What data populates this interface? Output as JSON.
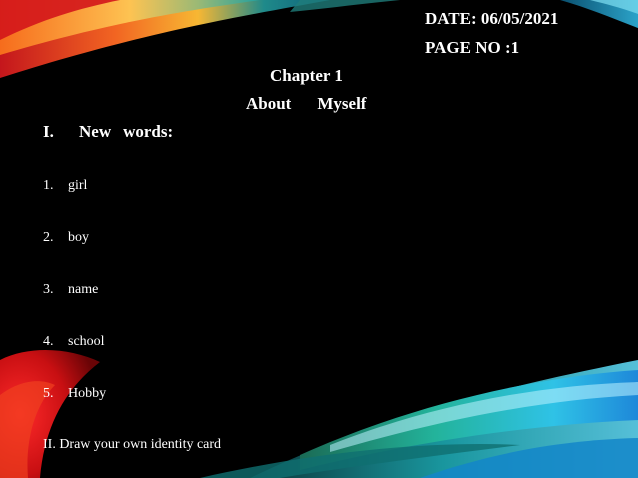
{
  "header": {
    "date": "DATE: 06/05/2021",
    "page_no": "PAGE NO :1"
  },
  "title": {
    "chapter": "Chapter 1",
    "subtitle_word1": "About",
    "subtitle_word2": "Myself"
  },
  "section": {
    "numeral": "I.",
    "word1": "New",
    "word2": "words:"
  },
  "words": [
    {
      "num": "1.",
      "text": "girl"
    },
    {
      "num": "2.",
      "text": "boy"
    },
    {
      "num": "3.",
      "text": "name"
    },
    {
      "num": "4.",
      "text": "school"
    },
    {
      "num": "5.",
      "text": "Hobby"
    }
  ],
  "task": "II. Draw your own identity card",
  "colors": {
    "background": "#000000",
    "text": "#ffffff",
    "accent_red": "#d81b1b",
    "accent_orange": "#f08a1c",
    "accent_teal": "#1fa9b8",
    "accent_blue": "#2ec4e8"
  }
}
